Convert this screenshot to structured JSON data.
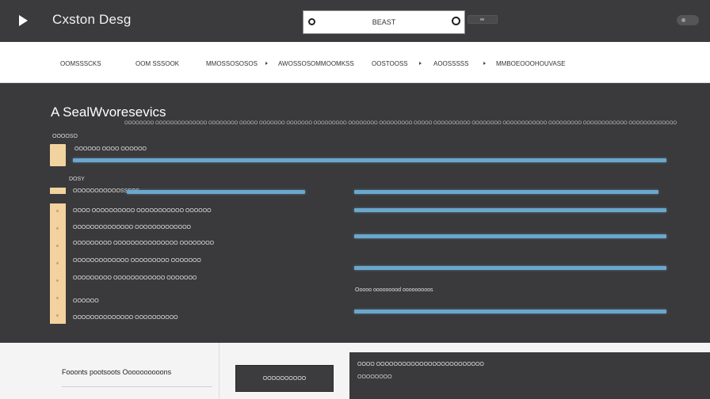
{
  "header": {
    "app_title": "Cxston Desg",
    "search": {
      "value": "BEAST"
    }
  },
  "nav": {
    "items": [
      {
        "label": "OOMSSSCKS"
      },
      {
        "label": "OOM SSSOOK"
      },
      {
        "label": "MMOSSOSOSOS"
      },
      {
        "label": "AWOSSOSOMMOOMKSS"
      },
      {
        "label": "OOSTOOSS"
      },
      {
        "label": "AOOSSSSS"
      },
      {
        "label": "MMBOEOOOHOUVASE"
      }
    ]
  },
  "main": {
    "title": "A SealWvoresevics",
    "subtitle": "OOOOOOOO OOOOOOOOOOOOOO OOOOOOOO OOOOO OOOOOOO OOOOOOO OOOOOOOOO OOOOOOOO OOOOOOOOO OOOOO OOOOOOOOOO OOOOOOOO OOOOOOOOOOOO OOOOOOOOO OOOOOOOOOOOO OOOOOOOOOOOOO",
    "section1": {
      "label": "OOOOSO",
      "row_label": "OOOOOO OOOO OOOOOO"
    },
    "section2": {
      "label": "DOSY",
      "row_label": "OOOOOOOOOOOSSSOS"
    },
    "left_rows": [
      {
        "label": "OOOO OOOOOOOOOO OOOOOOOOOOO OOOOOO"
      },
      {
        "label": "OOOOOOOOOOOOOO OOOOOOOOOOOOO"
      },
      {
        "label": "OOOOOOOOO OOOOOOOOOOOOOOO OOOOOOOO"
      },
      {
        "label": "OOOOOOOOOOOOO OOOOOOOOO OOOOOOO"
      },
      {
        "label": "OOOOOOOOO OOOOOOOOOOOO OOOOOOO"
      },
      {
        "label": "OOOOOO"
      },
      {
        "label": "OOOOOOOOOOOOOO OOOOOOOOOO"
      }
    ],
    "right_label": "Ooooo ooooooood ooooooooos"
  },
  "footer": {
    "heading": "Fooonts pootsoots Oooooooooons",
    "button_label": "OOOOOOOOOO",
    "panel_line1": "OOOO OOOOOOOOOOOOOOOOOOOOOOOOO",
    "panel_line2": "OOOOOOOO"
  },
  "colors": {
    "bar_blue": "#6aa7cc",
    "accent_tan": "#f2d29e",
    "header_dark": "#3b3b3d"
  },
  "icons": [
    "play-arrow-icon",
    "search-icon",
    "clear-icon",
    "toggle-icon",
    "user-avatar-icon"
  ]
}
